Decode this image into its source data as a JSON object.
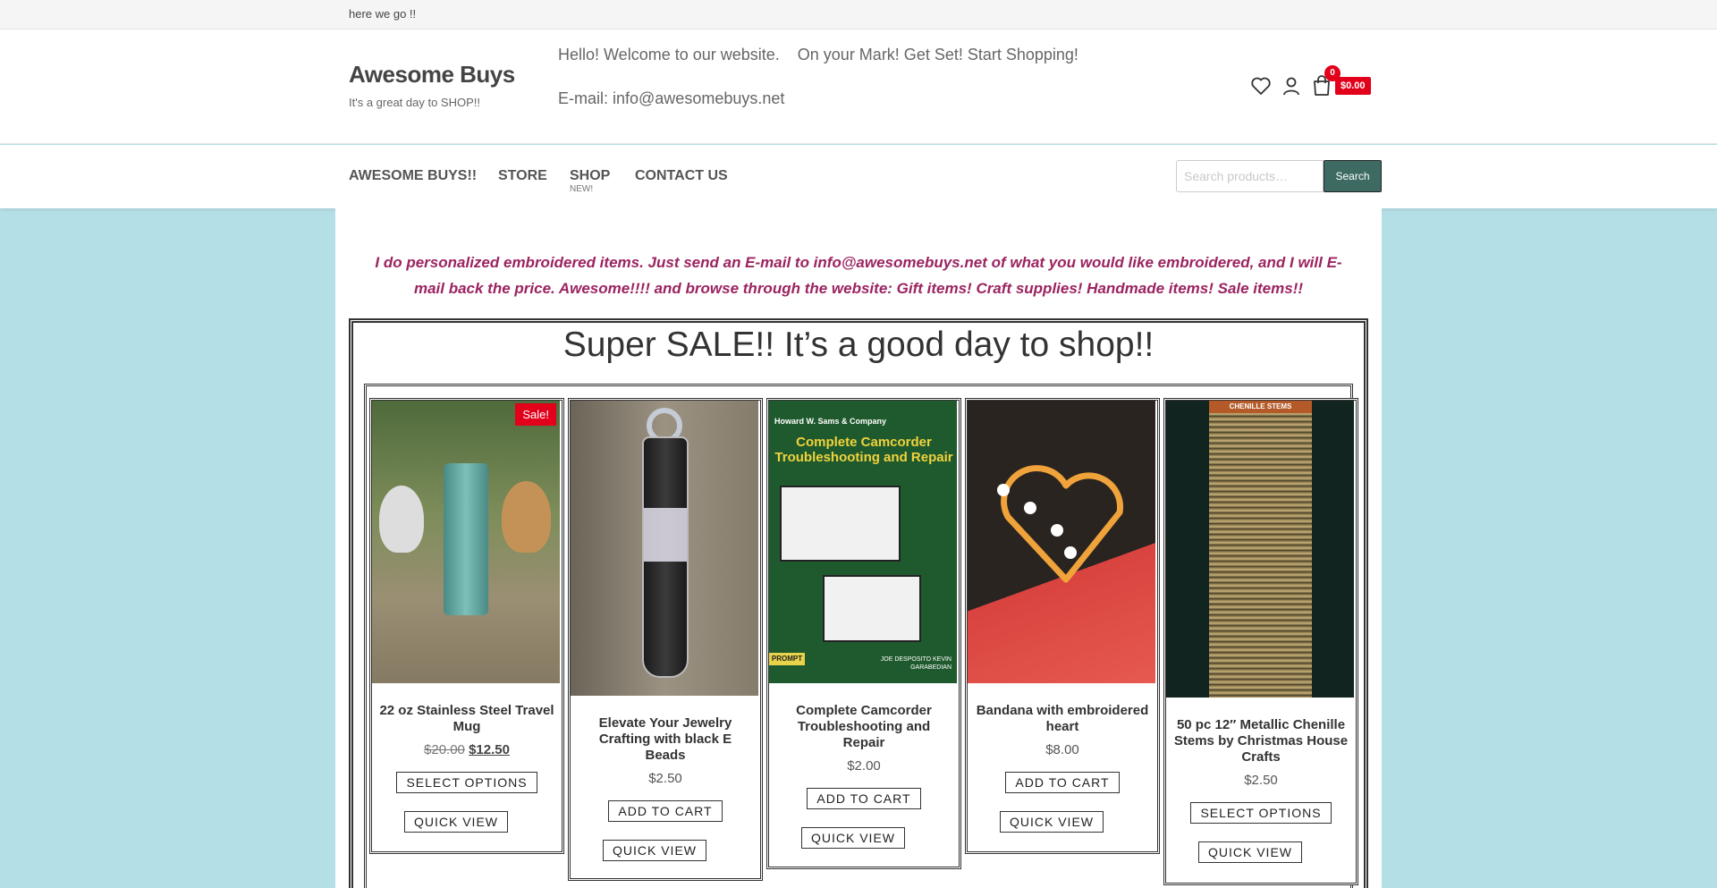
{
  "topbar": {
    "text": "here we go !!"
  },
  "header": {
    "site_title": "Awesome Buys",
    "tagline": "It's a great day to SHOP!!",
    "welcome_1": "Hello! Welcome to our website.",
    "welcome_2": "On your Mark! Get Set! Start Shopping!",
    "email": "E-mail: info@awesomebuys.net",
    "cart_count": "0",
    "cart_total": "$0.00"
  },
  "nav": {
    "items": [
      "AWESOME BUYS!!",
      "STORE",
      "SHOP",
      "CONTACT US"
    ],
    "shop_badge": "NEW!",
    "search_placeholder": "Search products…",
    "search_button": "Search"
  },
  "intro": "I do personalized embroidered items.  Just send an E-mail to info@awesomebuys.net of what you would like embroidered, and I will E-mail back the price. Awesome!!!! and browse through the website: Gift items!  Craft supplies! Handmade items!  Sale items!!",
  "sale": {
    "title": "Super SALE!!  It’s a good day to shop!!",
    "products": [
      {
        "name": "22 oz Stainless Steel Travel Mug",
        "price_old": "$20.00",
        "price_new": "$12.50",
        "button": "SELECT OPTIONS",
        "quick": "QUICK VIEW",
        "badge": "Sale!"
      },
      {
        "name": "Elevate Your Jewelry Crafting with black E Beads",
        "price": "$2.50",
        "button": "ADD TO CART",
        "quick": "QUICK VIEW"
      },
      {
        "name": "Complete Camcorder Troubleshooting and Repair",
        "price": "$2.00",
        "button": "ADD TO CART",
        "quick": "QUICK VIEW",
        "book_publisher": "Howard W. Sams & Company",
        "book_title": "Complete Camcorder Troubleshooting and Repair",
        "book_authors": "JOE DESPOSITO KEVIN GARABEDIAN",
        "book_series": "PROMPT"
      },
      {
        "name": "Bandana with embroidered heart",
        "price": "$8.00",
        "button": "ADD TO CART",
        "quick": "QUICK VIEW"
      },
      {
        "name": "50 pc 12″ Metallic Chenille Stems by Christmas House Crafts",
        "price": "$2.50",
        "button": "SELECT OPTIONS",
        "quick": "QUICK VIEW",
        "package_label": "CHENILLE STEMS"
      }
    ]
  },
  "colors": {
    "page_bg": "#b5dfe6",
    "accent_red": "#e2001a",
    "intro_text": "#9b2460",
    "search_btn": "#3d6b64"
  }
}
